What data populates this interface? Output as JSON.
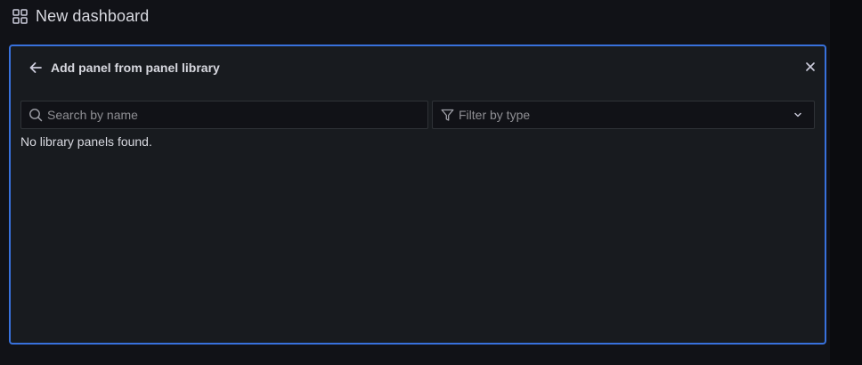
{
  "header": {
    "icon": "apps-grid-icon",
    "title": "New dashboard"
  },
  "panel": {
    "back_icon": "arrow-left-icon",
    "title": "Add panel from panel library",
    "close_icon": "close-icon",
    "border_color": "#3871dc"
  },
  "search": {
    "icon": "search-icon",
    "placeholder": "Search by name",
    "value": ""
  },
  "filter": {
    "icon": "filter-icon",
    "placeholder": "Filter by type",
    "chevron_icon": "chevron-down-icon"
  },
  "empty_message": "No library panels found."
}
